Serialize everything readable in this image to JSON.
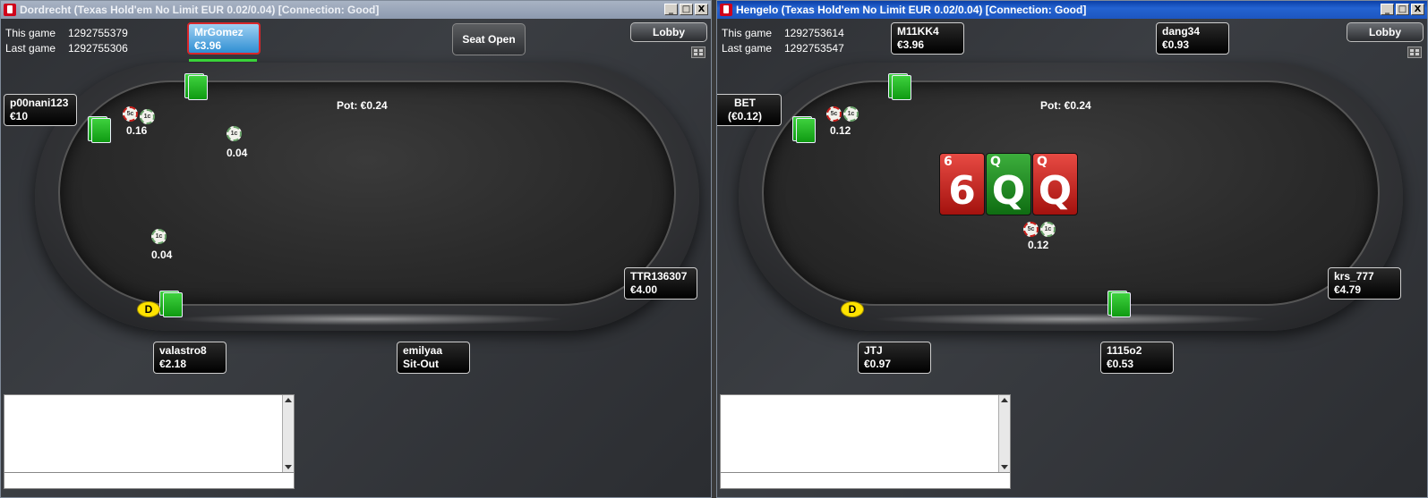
{
  "left_window": {
    "title": "Dordrecht (Texas Hold'em No Limit EUR 0.02/0.04)  [Connection: Good]",
    "window_buttons": [
      "_",
      "□",
      "X"
    ],
    "this_game_label": "This game",
    "this_game_value": "1292755379",
    "last_game_label": "Last game",
    "last_game_value": "1292755306",
    "lobby_label": "Lobby",
    "seat_open_label": "Seat Open",
    "pot_label": "Pot: €0.24",
    "seats": [
      {
        "name": "MrGomez",
        "stack": "€3.96"
      },
      {
        "name": "p00nani123",
        "stack": "€10"
      },
      {
        "name": "TTR136307",
        "stack": "€4.00"
      },
      {
        "name": "valastro8",
        "stack": "€2.18"
      },
      {
        "name": "emilyaa",
        "stack": "Sit-Out"
      }
    ],
    "bets": [
      "0.16",
      "0.04",
      "0.04"
    ],
    "dealer_label": "D",
    "chip_labels": {
      "five": "5c",
      "one": "1c"
    }
  },
  "right_window": {
    "title": "Hengelo (Texas Hold'em No Limit EUR 0.02/0.04)  [Connection: Good]",
    "window_buttons": [
      "_",
      "□",
      "X"
    ],
    "this_game_label": "This game",
    "this_game_value": "1292753614",
    "last_game_label": "Last game",
    "last_game_value": "1292753547",
    "lobby_label": "Lobby",
    "pot_label": "Pot: €0.24",
    "seats": [
      {
        "name": "M11KK4",
        "stack": "€3.96"
      },
      {
        "name": "dang34",
        "stack": "€0.93"
      },
      {
        "name": "BET",
        "stack": "(€0.12)"
      },
      {
        "name": "krs_777",
        "stack": "€4.79"
      },
      {
        "name": "JTJ",
        "stack": "€0.97"
      },
      {
        "name": "1115o2",
        "stack": "€0.53"
      }
    ],
    "bets": [
      "0.12",
      "0.12"
    ],
    "dealer_label": "D",
    "chip_labels": {
      "five": "5c",
      "one": "1c"
    },
    "board": [
      {
        "rank": "6",
        "color": "red"
      },
      {
        "rank": "Q",
        "color": "green"
      },
      {
        "rank": "Q",
        "color": "red"
      }
    ]
  },
  "colors": {
    "card_back": "#1fb31f",
    "active_seat": "#2f8fd3",
    "dealer_button": "#ffe300",
    "timer_bar": "#39d439"
  }
}
